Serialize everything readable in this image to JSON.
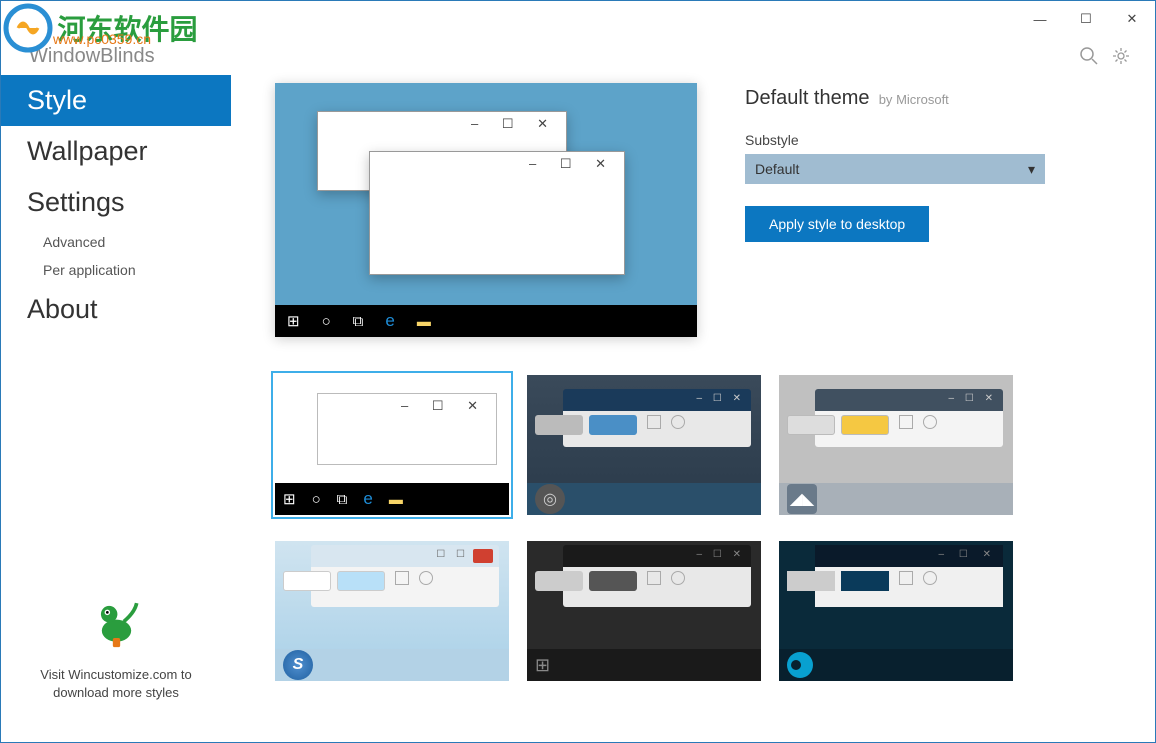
{
  "watermark": {
    "text": "河东软件园",
    "url": "www.pc0359.cn"
  },
  "app": {
    "name_prefix": "Window",
    "name_suffix": "Blinds"
  },
  "titlebar": {
    "minimize": "—",
    "maximize": "☐",
    "close": "✕"
  },
  "nav": {
    "style": "Style",
    "wallpaper": "Wallpaper",
    "settings": "Settings",
    "advanced": "Advanced",
    "per_application": "Per application",
    "about": "About"
  },
  "footer": {
    "text": "Visit Wincustomize.com to download more styles"
  },
  "theme": {
    "title": "Default theme",
    "by_label": "by",
    "by_value": "Microsoft",
    "substyle_label": "Substyle",
    "substyle_value": "Default",
    "apply_button": "Apply style to desktop"
  },
  "top_icons": {
    "search": "search",
    "settings": "settings"
  }
}
